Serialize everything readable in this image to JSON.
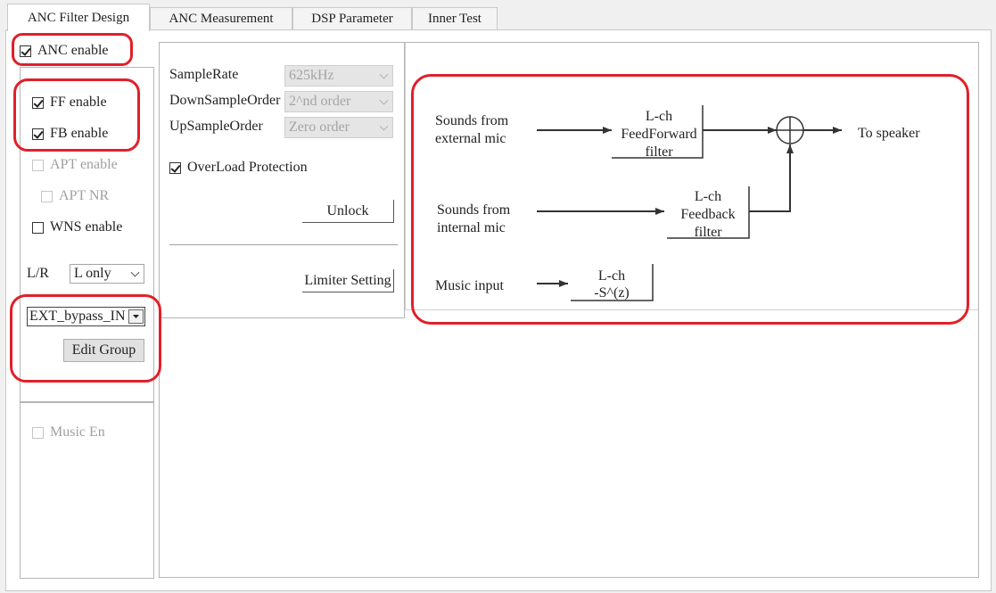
{
  "tabs": [
    {
      "label": "ANC Filter Design"
    },
    {
      "label": "ANC Measurement"
    },
    {
      "label": "DSP Parameter"
    },
    {
      "label": "Inner Test"
    }
  ],
  "left": {
    "anc_enable": {
      "label": "ANC enable",
      "checked": true
    },
    "ff_enable": {
      "label": "FF enable",
      "checked": true
    },
    "fb_enable": {
      "label": "FB enable",
      "checked": true
    },
    "apt_enable": {
      "label": "APT enable",
      "checked": false,
      "disabled": true
    },
    "apt_nr": {
      "label": "APT NR",
      "checked": false,
      "disabled": true
    },
    "wns_enable": {
      "label": "WNS enable",
      "checked": false
    },
    "lr_label": "L/R",
    "lr_value": "L only",
    "group_value": "EXT_bypass_IN",
    "edit_group": "Edit Group",
    "music_en": {
      "label": "Music En",
      "checked": false,
      "disabled": true
    }
  },
  "middle": {
    "samplerate_label": "SampleRate",
    "samplerate_value": "625kHz",
    "downsample_label": "DownSampleOrder",
    "downsample_value": "2^nd order",
    "upsample_label": "UpSampleOrder",
    "upsample_value": "Zero order",
    "overload": {
      "label": "OverLoad Protection",
      "checked": true
    },
    "unlock": "Unlock",
    "limiter": "Limiter Setting"
  },
  "diagram": {
    "ext_mic_1": "Sounds from",
    "ext_mic_2": "external mic",
    "ff_1": "L-ch",
    "ff_2": "FeedForward",
    "ff_3": "filter",
    "to_speaker": "To speaker",
    "int_mic_1": "Sounds from",
    "int_mic_2": "internal mic",
    "fb_1": "L-ch",
    "fb_2": "Feedback",
    "fb_3": "filter",
    "music_input": "Music input",
    "sz_1": "L-ch",
    "sz_2": "-S^(z)"
  },
  "colors": {
    "highlight": "#e0202a"
  }
}
